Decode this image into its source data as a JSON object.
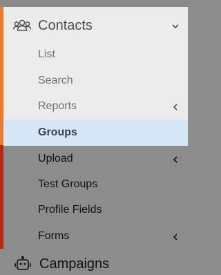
{
  "colors": {
    "accent_orange": "#f07a2a",
    "accent_red": "#b5280e",
    "active_bg": "#d6e6f6"
  },
  "sidebar": {
    "section": {
      "label": "Contacts",
      "icon": "contacts-group-icon",
      "toggle_icon": "chevron-down-icon"
    },
    "items": [
      {
        "label": "List"
      },
      {
        "label": "Search"
      },
      {
        "label": "Reports",
        "icon": "chevron-left-icon"
      },
      {
        "label": "Groups",
        "active": true
      },
      {
        "label": "Upload",
        "icon": "chevron-left-icon"
      },
      {
        "label": "Test Groups"
      },
      {
        "label": "Profile Fields"
      },
      {
        "label": "Forms",
        "icon": "chevron-left-icon"
      }
    ],
    "next_section": {
      "label": "Campaigns",
      "icon": "robot-icon"
    }
  }
}
